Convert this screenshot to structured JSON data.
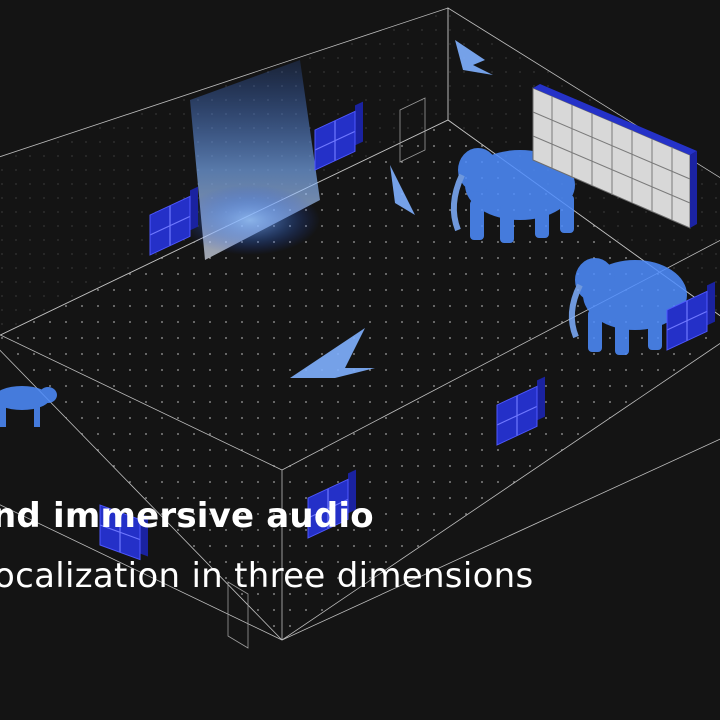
{
  "headline": "nd immersive audio",
  "subline": "ocalization in three dimensions",
  "colors": {
    "background": "#141414",
    "speaker_blue": "#2a32d8",
    "speaker_grid": "#5a64ff",
    "hologram": "#5b9cff",
    "wireframe": "#bdbdbd"
  },
  "icons": {
    "speaker": "speaker-array-icon",
    "elephant": "elephant-hologram",
    "bird": "bird-hologram",
    "cheetah": "cheetah-hologram",
    "waterfall": "waterfall-hologram"
  }
}
